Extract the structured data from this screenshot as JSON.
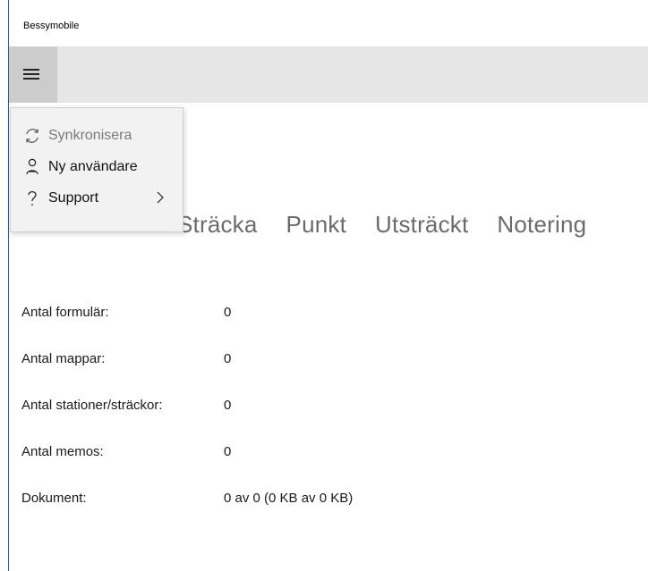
{
  "app": {
    "title": "Bessymobile"
  },
  "menu": {
    "items": [
      {
        "label": "Synkronisera",
        "icon": "sync-icon",
        "disabled": true
      },
      {
        "label": "Ny användare",
        "icon": "user-icon",
        "disabled": false
      },
      {
        "label": "Support",
        "icon": "help-icon",
        "disabled": false,
        "has_submenu": true
      }
    ]
  },
  "tabs": [
    "Sträcka",
    "Punkt",
    "Utsträckt",
    "Notering"
  ],
  "stats": [
    {
      "label": "Antal formulär:",
      "value": "0"
    },
    {
      "label": "Antal mappar:",
      "value": "0"
    },
    {
      "label": "Antal stationer/sträckor:",
      "value": "0"
    },
    {
      "label": "Antal memos:",
      "value": "0"
    },
    {
      "label": "Dokument:",
      "value": "0 av 0 (0 KB av 0 KB)"
    }
  ],
  "colors": {
    "window_border": "#1f5fae",
    "topbar": "#e6e6e6",
    "hamburger_bg": "#cccccc",
    "flyout_bg": "#f2f2f2",
    "tab_text": "#6b6b6b",
    "disabled_text": "#7a7a7a"
  }
}
